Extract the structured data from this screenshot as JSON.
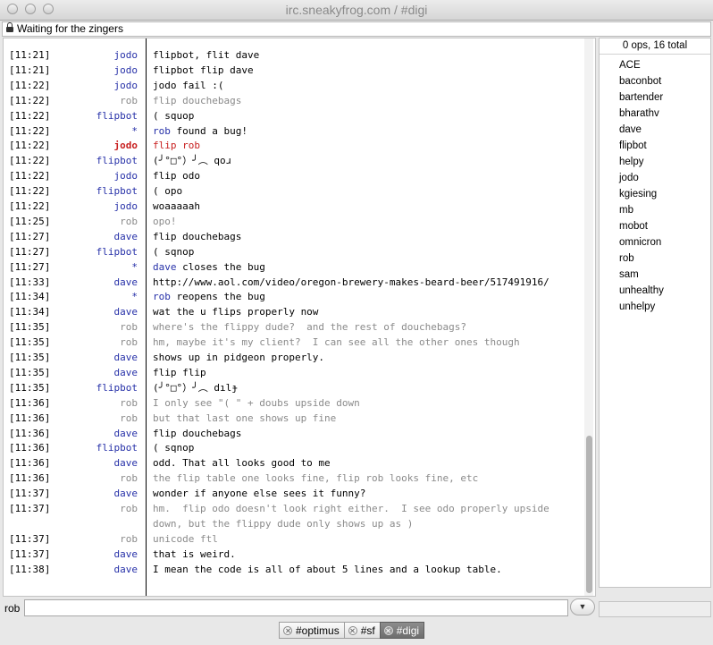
{
  "window": {
    "title": "irc.sneakyfrog.com / #digi"
  },
  "topic": "Waiting for the zingers",
  "users": {
    "header": "0 ops, 16 total",
    "list": [
      "ACE",
      "baconbot",
      "bartender",
      "bharathv",
      "dave",
      "flipbot",
      "helpy",
      "jodo",
      "kgiesing",
      "mb",
      "mobot",
      "omnicron",
      "rob",
      "sam",
      "unhealthy",
      "unhelpy"
    ]
  },
  "messages": [
    {
      "ts": "[11:21]",
      "nick": "jodo",
      "color": "blue",
      "text": "flipbot, flit dave"
    },
    {
      "ts": "[11:21]",
      "nick": "jodo",
      "color": "blue",
      "text": "flipbot flip dave"
    },
    {
      "ts": "[11:22]",
      "nick": "jodo",
      "color": "blue",
      "text": "jodo fail :("
    },
    {
      "ts": "[11:22]",
      "nick": "rob",
      "color": "gray",
      "text": "flip douchebags",
      "textcolor": "gray"
    },
    {
      "ts": "[11:22]",
      "nick": "flipbot",
      "color": "blue",
      "text": "( squop"
    },
    {
      "ts": "[11:22]",
      "nick": "*",
      "color": "blue",
      "action": "rob",
      "text": " found a bug!"
    },
    {
      "ts": "[11:22]",
      "nick": "jodo",
      "color": "red",
      "text": "flip rob",
      "textcolor": "red"
    },
    {
      "ts": "[11:22]",
      "nick": "flipbot",
      "color": "blue",
      "text": "(╯°□°）╯︵ qoɹ"
    },
    {
      "ts": "[11:22]",
      "nick": "jodo",
      "color": "blue",
      "text": "flip odo"
    },
    {
      "ts": "[11:22]",
      "nick": "flipbot",
      "color": "blue",
      "text": "( opo"
    },
    {
      "ts": "[11:22]",
      "nick": "jodo",
      "color": "blue",
      "text": "woaaaaah"
    },
    {
      "ts": "[11:25]",
      "nick": "rob",
      "color": "gray",
      "text": "opo!",
      "textcolor": "gray"
    },
    {
      "ts": "[11:27]",
      "nick": "dave",
      "color": "blue",
      "text": "flip douchebags"
    },
    {
      "ts": "[11:27]",
      "nick": "flipbot",
      "color": "blue",
      "text": "( sqnop"
    },
    {
      "ts": "[11:27]",
      "nick": "*",
      "color": "blue",
      "action": "dave",
      "text": " closes the bug"
    },
    {
      "ts": "[11:33]",
      "nick": "dave",
      "color": "blue",
      "text": "http://www.aol.com/video/oregon-brewery-makes-beard-beer/517491916/"
    },
    {
      "ts": "[11:34]",
      "nick": "*",
      "color": "blue",
      "action": "rob",
      "text": " reopens the bug"
    },
    {
      "ts": "[11:34]",
      "nick": "dave",
      "color": "blue",
      "text": "wat the u flips properly now"
    },
    {
      "ts": "[11:35]",
      "nick": "rob",
      "color": "gray",
      "text": "where's the flippy dude?  and the rest of douchebags?",
      "textcolor": "gray"
    },
    {
      "ts": "[11:35]",
      "nick": "rob",
      "color": "gray",
      "text": "hm, maybe it's my client?  I can see all the other ones though",
      "textcolor": "gray"
    },
    {
      "ts": "[11:35]",
      "nick": "dave",
      "color": "blue",
      "text": "shows up in pidgeon properly."
    },
    {
      "ts": "[11:35]",
      "nick": "dave",
      "color": "blue",
      "text": "flip flip"
    },
    {
      "ts": "[11:35]",
      "nick": "flipbot",
      "color": "blue",
      "text": "(╯°□°）╯︵ dılɟ"
    },
    {
      "ts": "[11:36]",
      "nick": "rob",
      "color": "gray",
      "text": "I only see \"( \" + doubs upside down",
      "textcolor": "gray"
    },
    {
      "ts": "[11:36]",
      "nick": "rob",
      "color": "gray",
      "text": "but that last one shows up fine",
      "textcolor": "gray"
    },
    {
      "ts": "[11:36]",
      "nick": "dave",
      "color": "blue",
      "text": "flip douchebags"
    },
    {
      "ts": "[11:36]",
      "nick": "flipbot",
      "color": "blue",
      "text": "( sqnop"
    },
    {
      "ts": "[11:36]",
      "nick": "dave",
      "color": "blue",
      "text": "odd. That all looks good to me"
    },
    {
      "ts": "[11:36]",
      "nick": "rob",
      "color": "gray",
      "text": "the flip table one looks fine, flip rob looks fine, etc",
      "textcolor": "gray"
    },
    {
      "ts": "[11:37]",
      "nick": "dave",
      "color": "blue",
      "text": "wonder if anyone else sees it funny?"
    },
    {
      "ts": "[11:37]",
      "nick": "rob",
      "color": "gray",
      "text": "hm.  flip odo doesn't look right either.  I see odo properly upside",
      "textcolor": "gray"
    },
    {
      "ts": "",
      "nick": "",
      "color": "gray",
      "text": "down, but the flippy dude only shows up as )",
      "textcolor": "gray"
    },
    {
      "ts": "[11:37]",
      "nick": "rob",
      "color": "gray",
      "text": "unicode ftl",
      "textcolor": "gray"
    },
    {
      "ts": "[11:37]",
      "nick": "dave",
      "color": "blue",
      "text": "that is weird."
    },
    {
      "ts": "[11:38]",
      "nick": "dave",
      "color": "blue",
      "text": "I mean the code is all of about 5 lines and a lookup table."
    }
  ],
  "input": {
    "nick": "rob",
    "value": ""
  },
  "tabs": [
    {
      "label": "#optimus",
      "active": false
    },
    {
      "label": "#sf",
      "active": false
    },
    {
      "label": "#digi",
      "active": true
    }
  ],
  "colors": {
    "blue": "#2630a8",
    "gray": "#8a8a8a",
    "red": "#c82020"
  }
}
